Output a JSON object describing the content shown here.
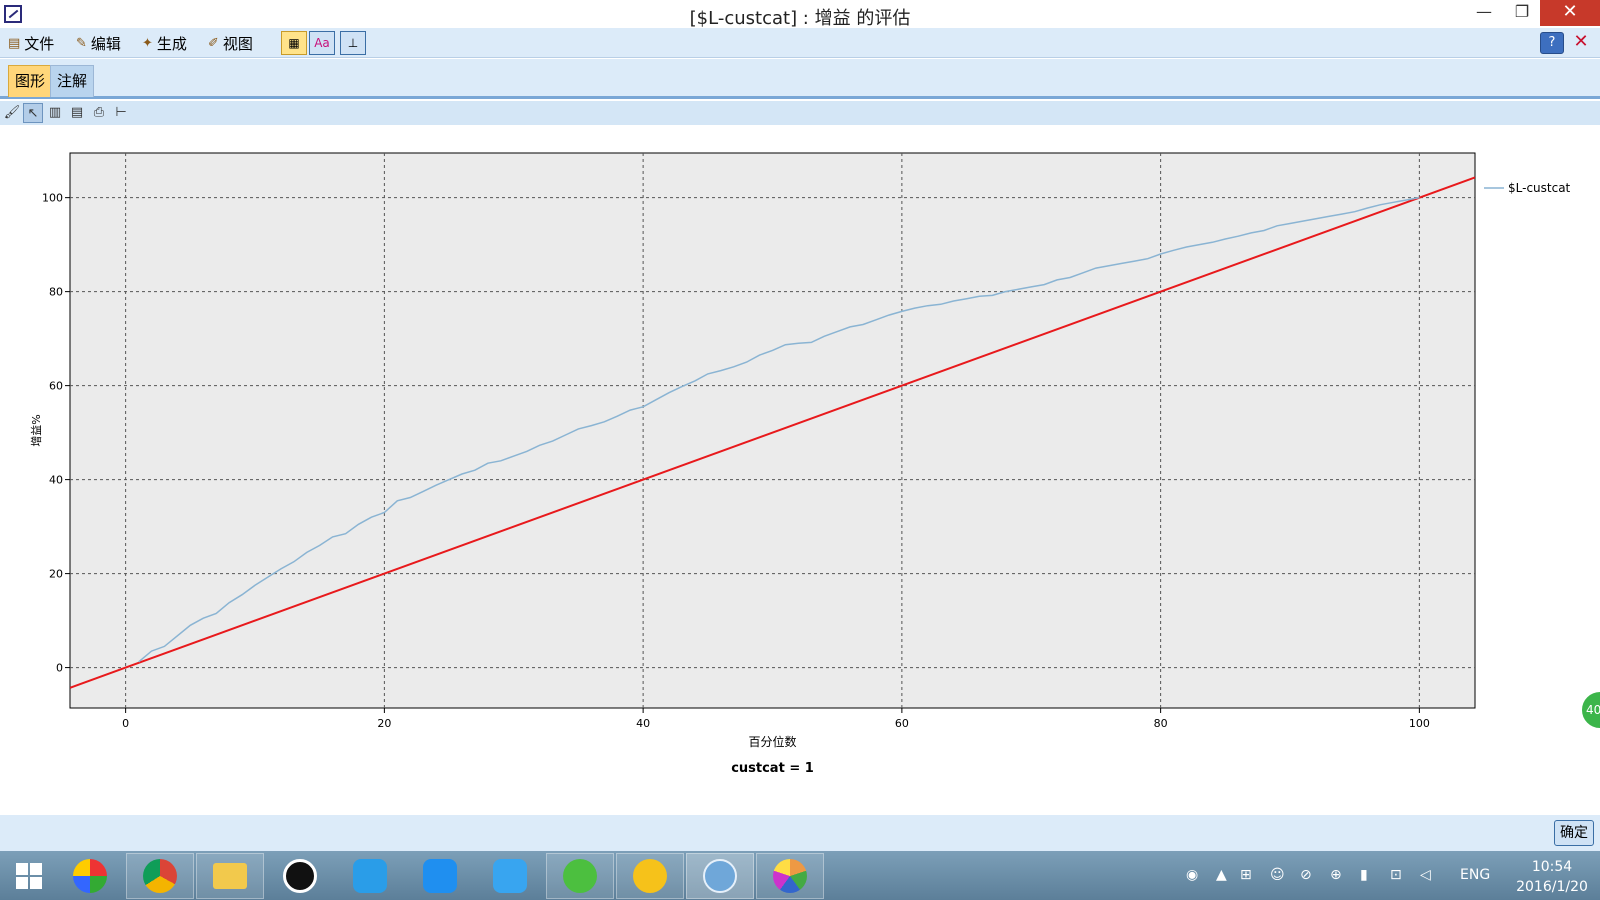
{
  "window": {
    "title": "[$L-custcat] : 增益 的评估",
    "minimize": "—",
    "maximize": "❐",
    "close": "✕"
  },
  "menu": [
    {
      "label": "文件",
      "glyph": "▤"
    },
    {
      "label": "编辑",
      "glyph": "✎"
    },
    {
      "label": "生成",
      "glyph": "✦"
    },
    {
      "label": "视图",
      "glyph": "✐"
    }
  ],
  "toolbar_icons": [
    "chart-grid-icon",
    "font-size-icon",
    "axis-icon"
  ],
  "tabs": [
    {
      "label": "图形",
      "active": true
    },
    {
      "label": "注解",
      "active": false
    }
  ],
  "tools": [
    "brush-icon",
    "pointer-icon",
    "copy-chart-icon",
    "copy-data-icon",
    "print-icon",
    "tree-icon"
  ],
  "ok_label": "确定",
  "badge": "40",
  "chart_data": {
    "type": "line",
    "title": "",
    "xlabel": "百分位数",
    "ylabel": "增益%",
    "subtitle": "custcat = 1",
    "xlim": [
      -4.3,
      104.3
    ],
    "ylim": [
      -8.6,
      109.5
    ],
    "xticks": [
      0,
      20,
      40,
      60,
      80,
      100
    ],
    "yticks": [
      0,
      20,
      40,
      60,
      80,
      100
    ],
    "grid": true,
    "legend": "right",
    "series": [
      {
        "name": "$L-custcat",
        "color": "#8ab4d3",
        "x": [
          1,
          2,
          3,
          5,
          6,
          7,
          8,
          9,
          10,
          12,
          13,
          14,
          15,
          16,
          17,
          18,
          19,
          20,
          21,
          22,
          23,
          24,
          25,
          26,
          27,
          28,
          29,
          30,
          31,
          32,
          33,
          34,
          35,
          36,
          37,
          38,
          39,
          40,
          41,
          42,
          43,
          44,
          45,
          46,
          47,
          48,
          49,
          50,
          51,
          52,
          53,
          54,
          55,
          56,
          57,
          58,
          59,
          60,
          61,
          62,
          63,
          64,
          65,
          66,
          67,
          68,
          69,
          70,
          71,
          72,
          73,
          74,
          75,
          76,
          77,
          78,
          79,
          80,
          81,
          82,
          83,
          84,
          85,
          86,
          87,
          88,
          89,
          90,
          91,
          92,
          93,
          94,
          95,
          96,
          97,
          98,
          99,
          100
        ],
        "values": [
          1.2,
          3.5,
          4.5,
          9.0,
          10.5,
          11.5,
          13.8,
          15.5,
          17.5,
          21.0,
          22.5,
          24.5,
          26.0,
          27.8,
          28.5,
          30.5,
          32.0,
          33.0,
          35.5,
          36.2,
          37.5,
          38.8,
          40.0,
          41.2,
          42.0,
          43.5,
          44.0,
          45.0,
          46.0,
          47.3,
          48.2,
          49.5,
          50.8,
          51.5,
          52.3,
          53.5,
          54.8,
          55.5,
          57.0,
          58.5,
          59.8,
          61.0,
          62.5,
          63.2,
          64.0,
          65.0,
          66.5,
          67.5,
          68.7,
          69.0,
          69.2,
          70.5,
          71.5,
          72.5,
          73.0,
          74.0,
          75.0,
          75.8,
          76.5,
          77.0,
          77.3,
          78.0,
          78.5,
          79.0,
          79.2,
          80.0,
          80.5,
          81.0,
          81.5,
          82.5,
          83.0,
          84.0,
          85.0,
          85.5,
          86.0,
          86.5,
          87.0,
          88.0,
          88.8,
          89.5,
          90.0,
          90.5,
          91.2,
          91.8,
          92.5,
          93.0,
          94.0,
          94.5,
          95.0,
          95.5,
          96.0,
          96.5,
          97.0,
          97.8,
          98.5,
          99.0,
          99.5,
          100.0
        ]
      }
    ],
    "baseline": {
      "color": "#e8191c",
      "x": [
        -4.3,
        104.3
      ],
      "values": [
        -4.3,
        104.3
      ]
    }
  }
}
